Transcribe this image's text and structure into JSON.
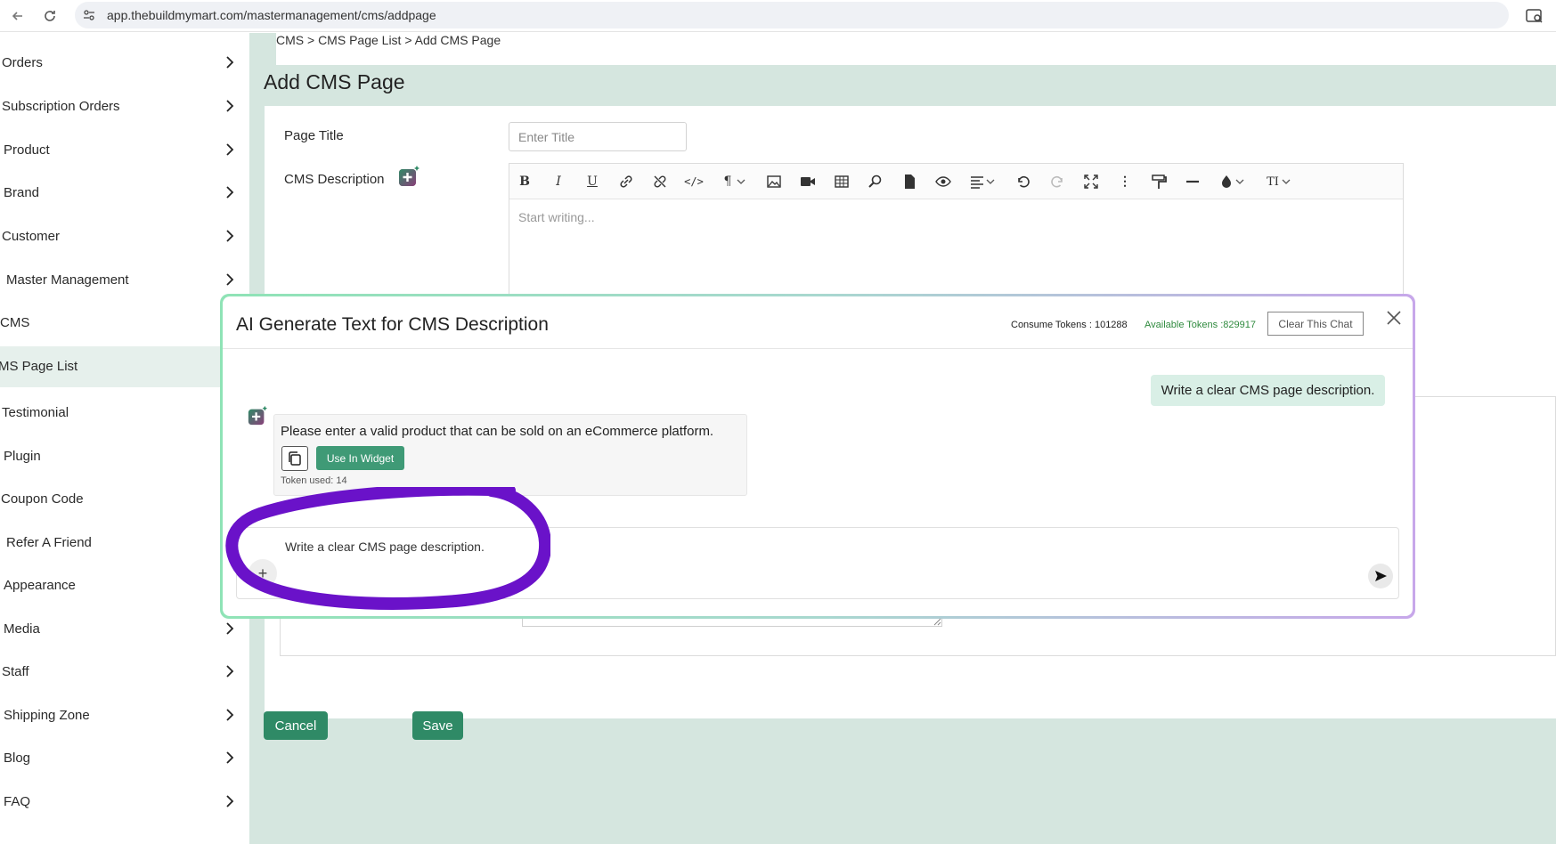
{
  "browser": {
    "url": "app.thebuildmymart.com/mastermanagement/cms/addpage"
  },
  "sidebar": {
    "items": [
      {
        "label": "Orders",
        "has_arrow": true
      },
      {
        "label": "Subscription Orders",
        "has_arrow": true
      },
      {
        "label": "Product",
        "has_arrow": true
      },
      {
        "label": "Brand",
        "has_arrow": true
      },
      {
        "label": "Customer",
        "has_arrow": true
      },
      {
        "label": "Master Management",
        "has_arrow": true
      },
      {
        "label": "CMS",
        "has_arrow": false
      },
      {
        "label": "MS Page List",
        "has_arrow": false,
        "active": true
      },
      {
        "label": "Testimonial",
        "has_arrow": false
      },
      {
        "label": "Plugin",
        "has_arrow": false
      },
      {
        "label": "Coupon Code",
        "has_arrow": false
      },
      {
        "label": "Refer A Friend",
        "has_arrow": false
      },
      {
        "label": "Appearance",
        "has_arrow": false
      },
      {
        "label": "Media",
        "has_arrow": true
      },
      {
        "label": "Staff",
        "has_arrow": true
      },
      {
        "label": "Shipping Zone",
        "has_arrow": true
      },
      {
        "label": "Blog",
        "has_arrow": true
      },
      {
        "label": "FAQ",
        "has_arrow": true
      }
    ]
  },
  "main": {
    "breadcrumb": "CMS > CMS Page List > Add CMS Page",
    "page_title": "Add CMS Page",
    "page_title_label": "Page Title",
    "page_title_placeholder": "Enter Title",
    "cms_description_label": "CMS Description",
    "editor_placeholder": "Start writing...",
    "cancel_label": "Cancel",
    "save_label": "Save"
  },
  "modal": {
    "title": "AI Generate Text for CMS Description",
    "consume_tokens": "Consume Tokens : 101288",
    "available_tokens": "Available Tokens :829917",
    "clear_label": "Clear This Chat",
    "user_message": "Write a clear CMS page description.",
    "ai_message": "Please enter a valid product that can be sold on an eCommerce platform.",
    "use_widget_label": "Use In Widget",
    "token_used": "Token used: 14",
    "input_value": "Write a clear CMS page description."
  },
  "colors": {
    "accent": "#2f8a66",
    "main_bg": "#d5e6df",
    "annotation": "#6a12c9",
    "available_tokens": "#2f8a3e"
  }
}
